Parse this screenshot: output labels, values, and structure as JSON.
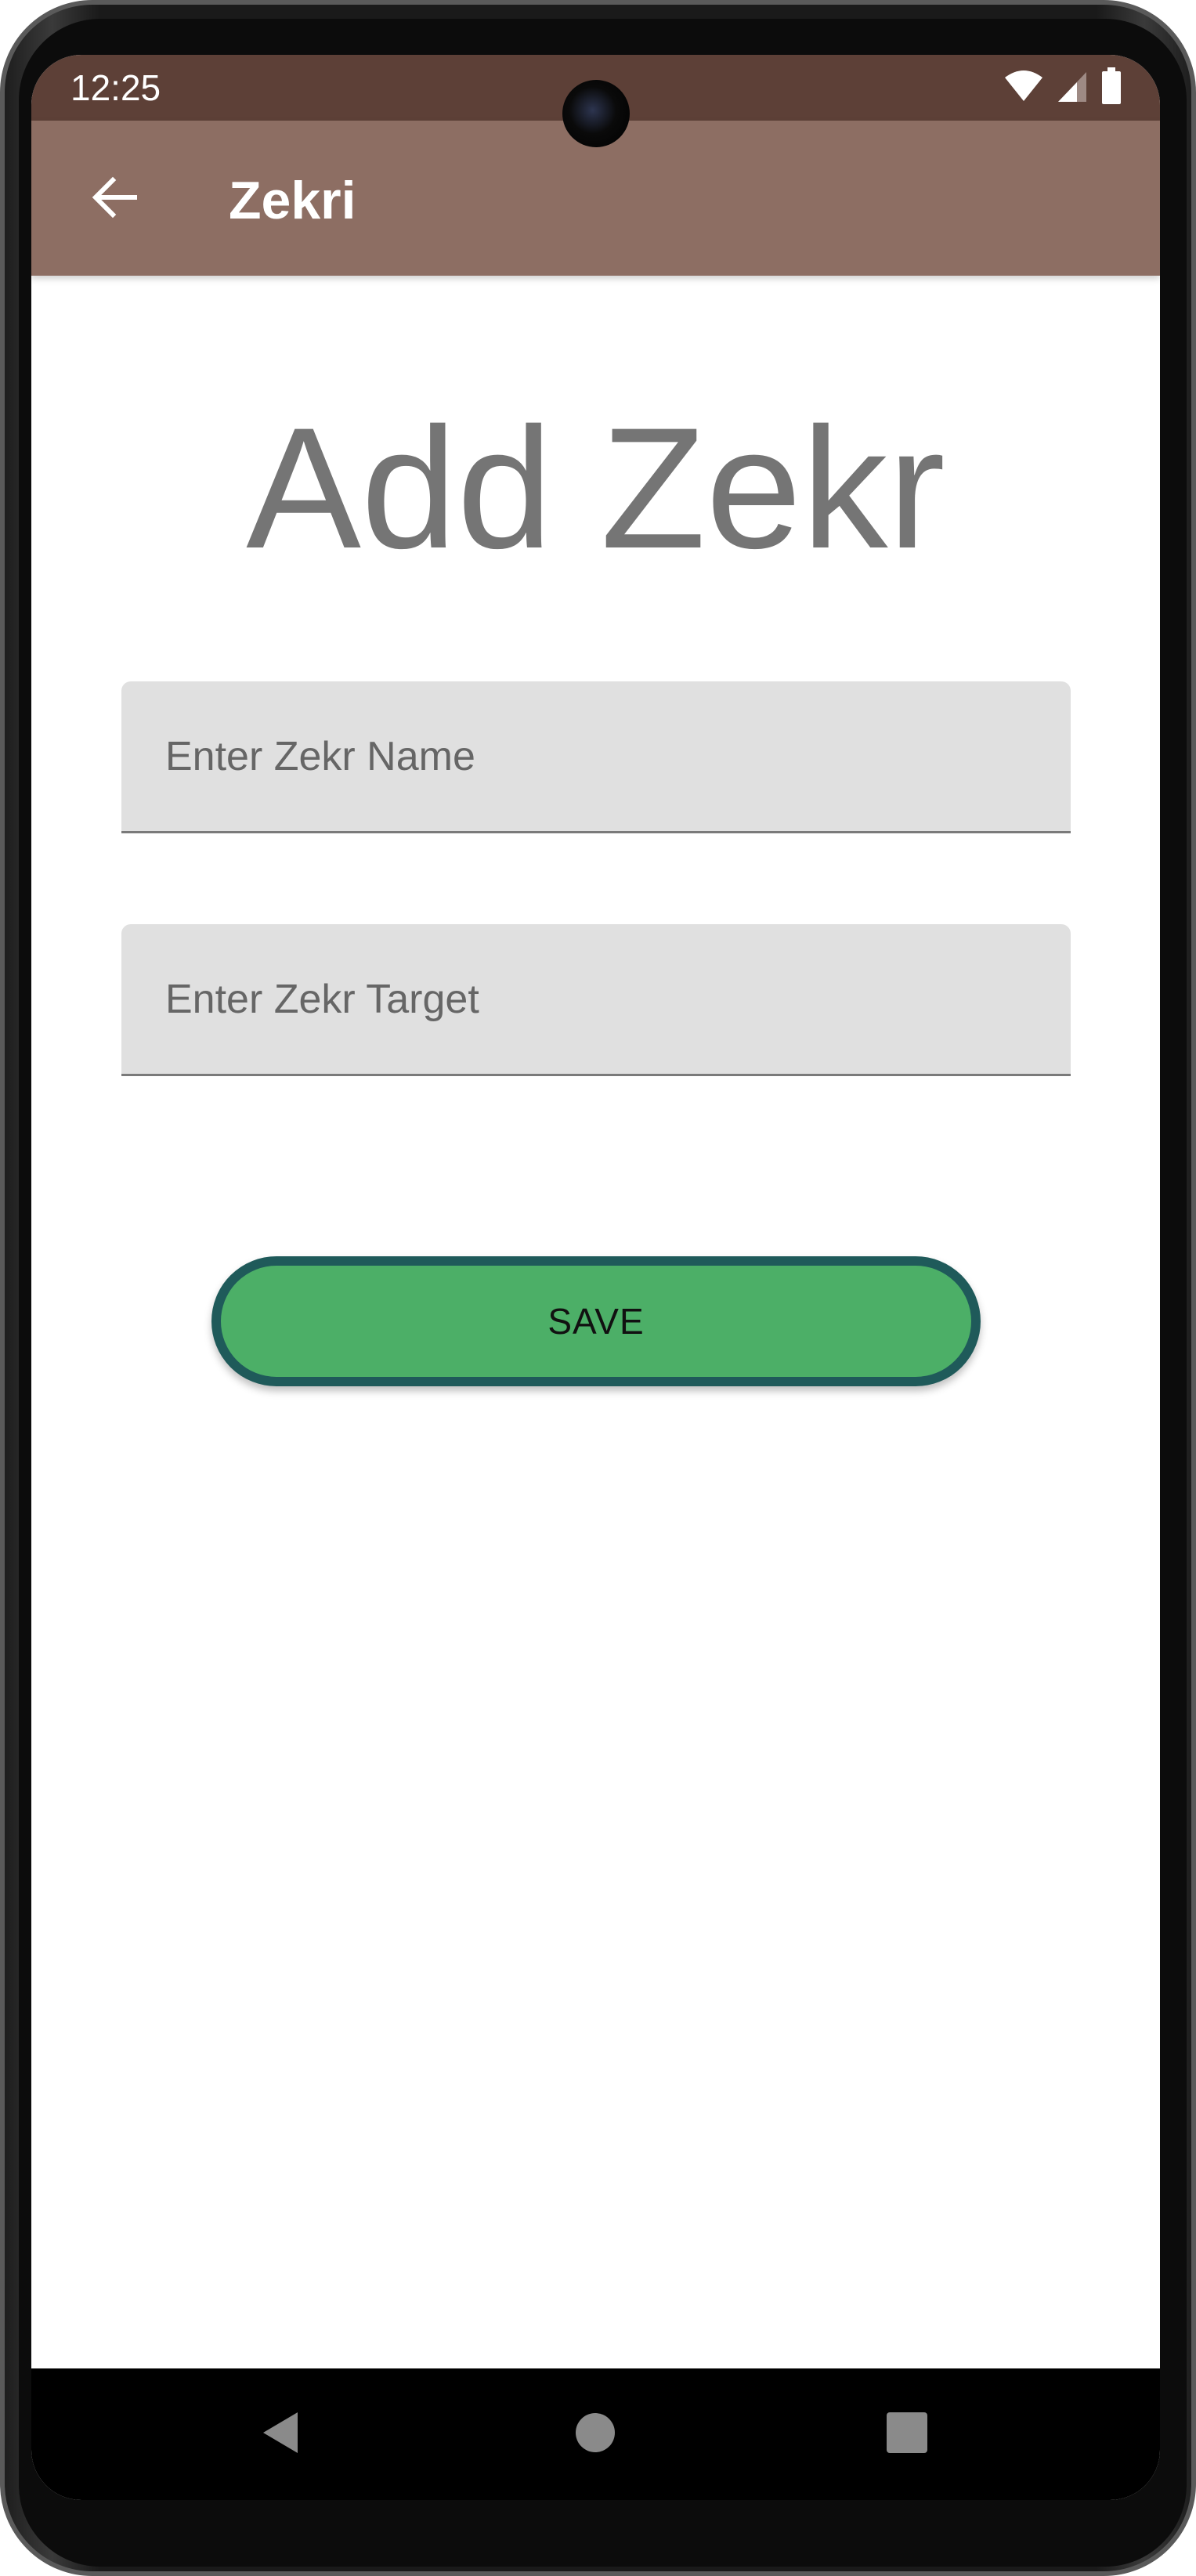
{
  "status_bar": {
    "time": "12:25",
    "icons": [
      "wifi-icon",
      "cell-signal-icon",
      "battery-icon"
    ],
    "background": "#5d4037"
  },
  "app_bar": {
    "title": "Zekri",
    "back_icon": "arrow-back-icon",
    "background": "#8d6e63"
  },
  "page": {
    "heading": "Add Zekr"
  },
  "form": {
    "name_field": {
      "placeholder": "Enter Zekr Name",
      "value": ""
    },
    "target_field": {
      "placeholder": "Enter Zekr Target",
      "value": ""
    },
    "save_button": {
      "label": "SAVE",
      "fill_color": "#4caf67",
      "border_color": "#1f5a5a"
    }
  },
  "nav_bar": {
    "buttons": [
      "nav-back-icon",
      "nav-home-icon",
      "nav-recents-icon"
    ]
  }
}
